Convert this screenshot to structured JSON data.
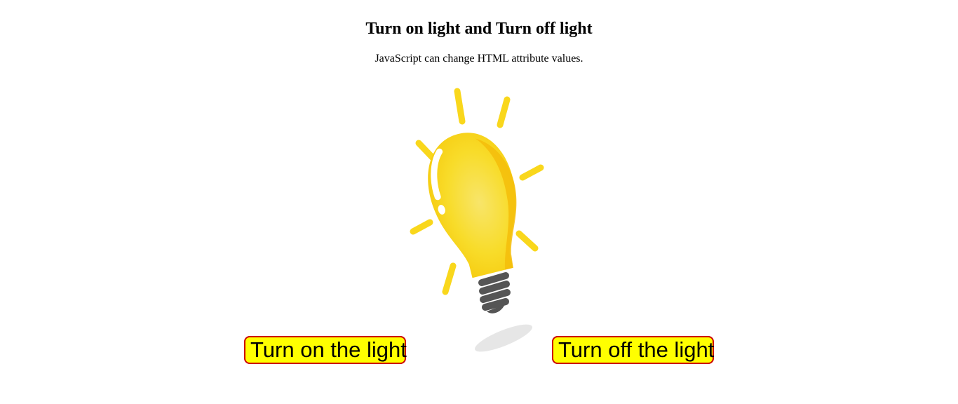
{
  "page": {
    "title": "Turn on light and Turn off light",
    "subtitle": "JavaScript can change HTML attribute values."
  },
  "bulb": {
    "state": "on",
    "glow_color": "#f9d71c",
    "base_color": "#555555",
    "icon": "lightbulb-icon"
  },
  "buttons": {
    "on_label": "Turn on the light",
    "off_label": "Turn off the light",
    "background": "#ffff00",
    "border": "#cc0000"
  }
}
